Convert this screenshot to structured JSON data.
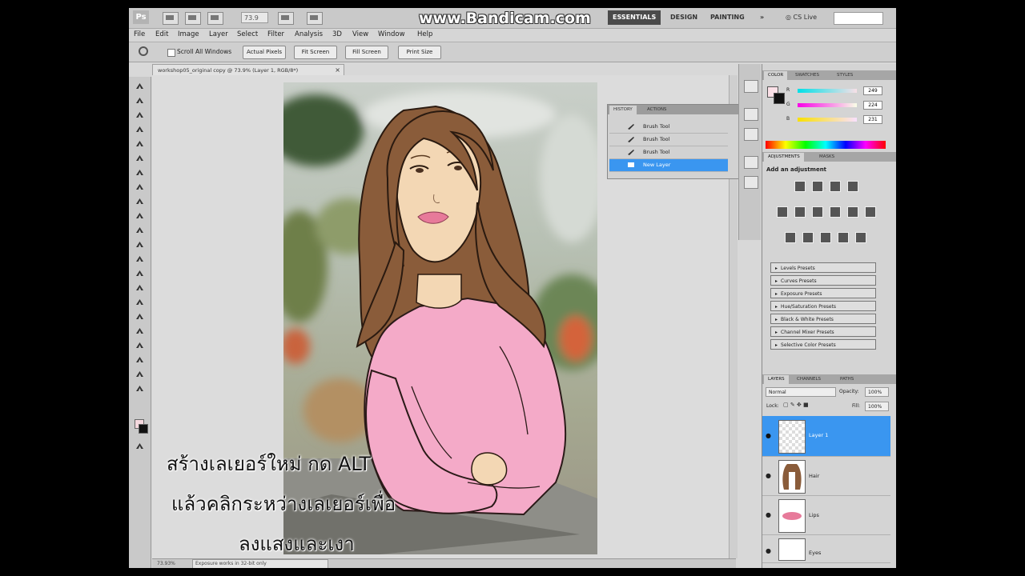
{
  "watermark": "www.Bandicam.com",
  "app": {
    "logo": "Ps",
    "zoom": "73.9",
    "workspaces": [
      "ESSENTIALS",
      "DESIGN",
      "PAINTING"
    ],
    "workspace_more": "»",
    "cs_live": "CS Live"
  },
  "menu": [
    "File",
    "Edit",
    "Image",
    "Layer",
    "Select",
    "Filter",
    "Analysis",
    "3D",
    "View",
    "Window",
    "Help"
  ],
  "options_bar": {
    "scroll_all": "Scroll All Windows",
    "buttons": [
      "Actual Pixels",
      "Fit Screen",
      "Fill Screen",
      "Print Size"
    ]
  },
  "document": {
    "tab_title": "workshop05_original copy @ 73.9% (Layer 1, RGB/8*)",
    "zoom_status": "73.93%",
    "status_text": "Exposure works in 32-bit only"
  },
  "caption": {
    "line1": "สร้างเลเยอร์ใหม่ กด ALT",
    "line2": "แล้วคลิกระหว่างเลเยอร์เพื่อ",
    "line3": "ลงแสงและเงา"
  },
  "history_panel": {
    "tabs": [
      "HISTORY",
      "ACTIONS"
    ],
    "items": [
      "Brush Tool",
      "Brush Tool",
      "Brush Tool",
      "New Layer"
    ],
    "selected_index": 3
  },
  "color_panel": {
    "tabs": [
      "COLOR",
      "SWATCHES",
      "STYLES"
    ],
    "channels": [
      {
        "label": "R",
        "value": "249",
        "color": "#e83030"
      },
      {
        "label": "G",
        "value": "224",
        "color": "#30c030"
      },
      {
        "label": "B",
        "value": "231",
        "color": "#3050e0"
      }
    ]
  },
  "adjustments_panel": {
    "tabs": [
      "ADJUSTMENTS",
      "MASKS"
    ],
    "title": "Add an adjustment",
    "presets": [
      "Levels Presets",
      "Curves Presets",
      "Exposure Presets",
      "Hue/Saturation Presets",
      "Black & White Presets",
      "Channel Mixer Presets",
      "Selective Color Presets"
    ]
  },
  "layers_panel": {
    "tabs": [
      "LAYERS",
      "CHANNELS",
      "PATHS"
    ],
    "blend_mode": "Normal",
    "opacity_label": "Opacity:",
    "opacity": "100%",
    "lock_label": "Lock:",
    "fill_label": "Fill:",
    "fill": "100%",
    "layers": [
      {
        "name": "Layer 1",
        "selected": true
      },
      {
        "name": "Hair",
        "selected": false
      },
      {
        "name": "Lips",
        "selected": false
      },
      {
        "name": "Eyes",
        "selected": false
      }
    ]
  },
  "colors": {
    "selection": "#3a96f0",
    "sweater": "#f4aac8",
    "hair": "#8a5c3a",
    "skin": "#f3d7b4"
  }
}
